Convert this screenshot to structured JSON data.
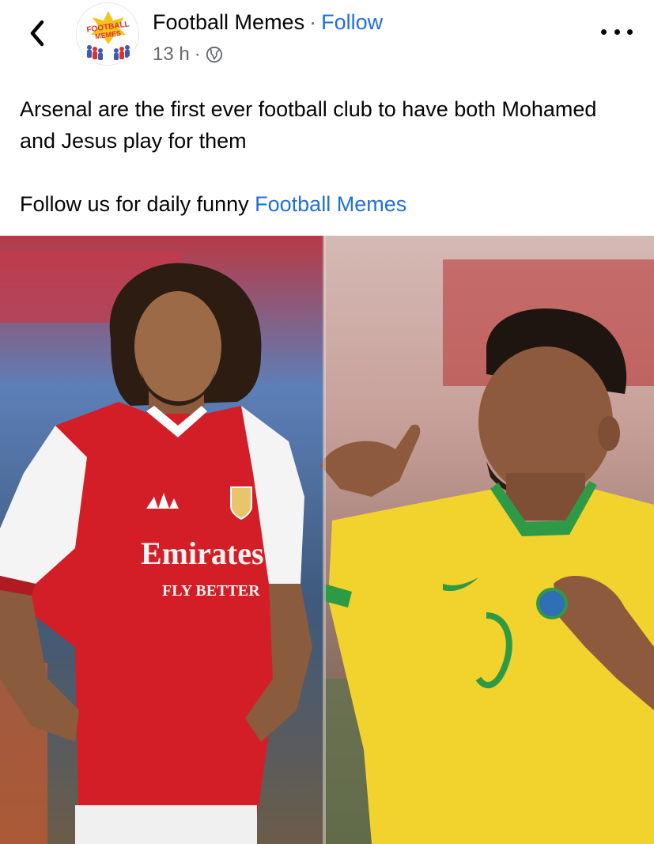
{
  "header": {
    "back_icon": "chevron-left-icon",
    "avatar_text_line1": "FOOTBALL",
    "avatar_text_line2": "MEMES",
    "page_name": "Football Memes",
    "separator": "·",
    "follow_label": "Follow",
    "time": "13 h",
    "time_separator": "·",
    "audience_icon": "globe-icon",
    "more_icon": "more-horizontal-icon"
  },
  "post": {
    "text_line1": "Arsenal are the first ever football club to have both Mohamed and Jesus play for them",
    "text_line2_prefix": "Follow us for daily funny ",
    "text_line2_link": "Football Memes"
  },
  "photo": {
    "left_shirt_sponsor_line1": "Emirates",
    "left_shirt_sponsor_line2": "FLY BETTER"
  },
  "colors": {
    "link_blue": "#216fdb",
    "secondary_text": "#65676b",
    "arsenal_red": "#d41e27",
    "brazil_yellow": "#f2d22c",
    "brazil_green": "#2f9a45"
  }
}
